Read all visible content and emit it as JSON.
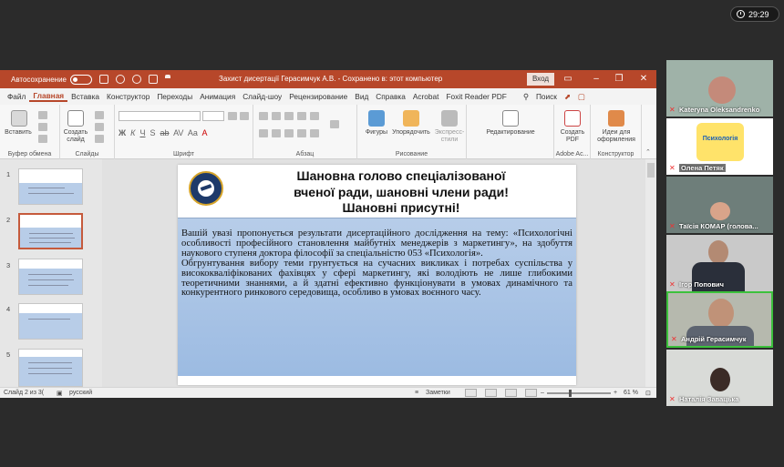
{
  "meeting": {
    "timer": "29:29"
  },
  "ppt": {
    "autosave_label": "Автосохранение",
    "doc_title": "Захист дисертації Герасимчук А.В.  -  Сохранено в: этот компьютер",
    "signin_label": "Вход",
    "menu": [
      "Файл",
      "Главная",
      "Вставка",
      "Конструктор",
      "Переходы",
      "Анимация",
      "Слайд-шоу",
      "Рецензирование",
      "Вид",
      "Справка",
      "Acrobat",
      "Foxit Reader PDF"
    ],
    "search_label": "Поиск",
    "ribbon": {
      "insert_label": "Вставить",
      "new_slide_label": "Создать слайд",
      "slides_label": "Слайды",
      "clipboard_label": "Буфер обмена",
      "font_label": "Шрифт",
      "paragraph_label": "Абзац",
      "shapes_label": "Фигуры",
      "arrange_label": "Упорядочить",
      "quick_styles_label": "Экспресс-стили",
      "drawing_label": "Рисование",
      "editing_label": "Редактирование",
      "create_pdf_label": "Создать PDF",
      "adobe_label": "Adobe Ac...",
      "design_ideas_label": "Идеи для оформления",
      "designer_label": "Конструктор",
      "font_style_glyphs": [
        "Ж",
        "К",
        "Ч",
        "S",
        "ab",
        "AV",
        "Aa",
        "A"
      ]
    },
    "thumb_numbers": [
      "1",
      "2",
      "3",
      "4",
      "5"
    ],
    "slide": {
      "title_line1": "Шановна голово спеціалізованої",
      "title_line2": "вченої ради, шановні члени ради!",
      "title_line3": "Шановні присутні!",
      "paragraph1": "Вашій увазі пропонується результати дисертаційного дослідження на тему: «Психологічні особливості професійного становлення майбутніх менеджерів з маркетингу», на здобуття наукового ступеня доктора філософії за спеціальністю 053 «Психологія».",
      "paragraph2": "Обгрунтування вибору теми грунтується на сучасних викликах і потребах суспільства у висококваліфікованих фахівцях у сфері маркетингу, які володіють не лише глибокими теоретичними знаннями, а й здатні ефективно функціонувати в умовах динамічного та конкурентного ринкового середовища, особливо в умовах воєнного часу."
    },
    "status": {
      "slide_info": "Слайд 2 из 3(",
      "language": "русский",
      "notes_label": "Заметки",
      "zoom": "61 %"
    }
  },
  "participants": [
    {
      "name": "Kateryna Oleksandrenko",
      "muted": true,
      "bg": "#9fb2a8"
    },
    {
      "name": "Олена Петяк",
      "muted": true,
      "bg": "#ffffff"
    },
    {
      "name": "Таїсія КОМАР (голова...",
      "muted": true,
      "bg": "#6e7e7a"
    },
    {
      "name": "Ігор Попович",
      "muted": true,
      "bg": "#c9c9c9"
    },
    {
      "name": "Андрій Герасимчук",
      "muted": true,
      "bg": "#b6b9ae"
    },
    {
      "name": "Наталія Завацька",
      "muted": true,
      "bg": "#d9dbd8"
    }
  ],
  "participant_logo_text": "Психологія",
  "colors": {
    "ppt_accent": "#b7472a",
    "speaker_border": "#3cc13c"
  }
}
